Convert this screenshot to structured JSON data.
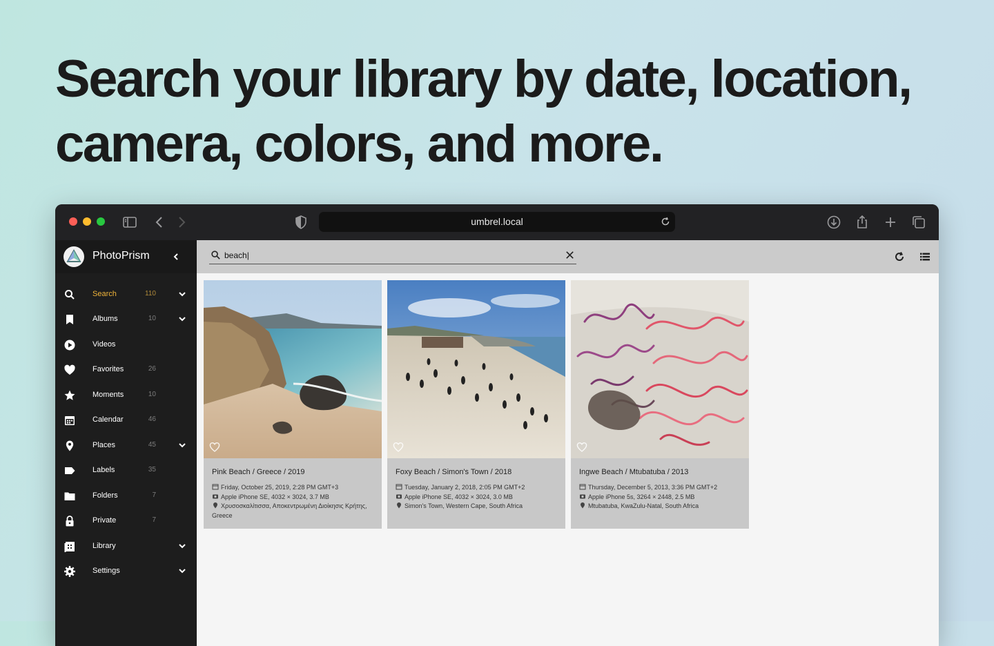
{
  "headline": {
    "line1": "Search your library by date, location,",
    "line2": "camera, colors, and more."
  },
  "browser": {
    "url": "umbrel.local"
  },
  "app": {
    "name": "PhotoPrism"
  },
  "sidebar": {
    "items": [
      {
        "label": "Search",
        "count": "110",
        "icon": "search-icon",
        "active": true,
        "expandable": true
      },
      {
        "label": "Albums",
        "count": "10",
        "icon": "bookmark-icon",
        "expandable": true
      },
      {
        "label": "Videos",
        "count": "",
        "icon": "play-icon"
      },
      {
        "label": "Favorites",
        "count": "26",
        "icon": "heart-icon"
      },
      {
        "label": "Moments",
        "count": "10",
        "icon": "star-icon"
      },
      {
        "label": "Calendar",
        "count": "46",
        "icon": "calendar-icon"
      },
      {
        "label": "Places",
        "count": "45",
        "icon": "pin-icon",
        "expandable": true
      },
      {
        "label": "Labels",
        "count": "35",
        "icon": "tag-icon"
      },
      {
        "label": "Folders",
        "count": "7",
        "icon": "folder-icon"
      },
      {
        "label": "Private",
        "count": "7",
        "icon": "lock-icon"
      },
      {
        "label": "Library",
        "count": "",
        "icon": "library-icon",
        "expandable": true
      },
      {
        "label": "Settings",
        "count": "",
        "icon": "gear-icon",
        "expandable": true
      }
    ]
  },
  "search": {
    "value": "beach|"
  },
  "photos": [
    {
      "title": "Pink Beach / Greece / 2019",
      "date": "Friday, October 25, 2019, 2:28 PM GMT+3",
      "camera": "Apple iPhone SE, 4032 × 3024, 3.7 MB",
      "location": "Χρυσοσκαλίτισσα, Αποκεντρωμένη Διοίκησις Κρήτης, Greece"
    },
    {
      "title": "Foxy Beach / Simon's Town / 2018",
      "date": "Tuesday, January 2, 2018, 2:05 PM GMT+2",
      "camera": "Apple iPhone SE, 4032 × 3024, 3.0 MB",
      "location": "Simon's Town, Western Cape, South Africa"
    },
    {
      "title": "Ingwe Beach / Mtubatuba / 2013",
      "date": "Thursday, December 5, 2013, 3:36 PM GMT+2",
      "camera": "Apple iPhone 5s, 3264 × 2448, 2.5 MB",
      "location": "Mtubatuba, KwaZulu-Natal, South Africa"
    }
  ],
  "colors": {
    "active_nav": "#f0b43a",
    "toolbar_bg": "#cbcbcb",
    "sidebar_bg": "#1d1d1d"
  }
}
